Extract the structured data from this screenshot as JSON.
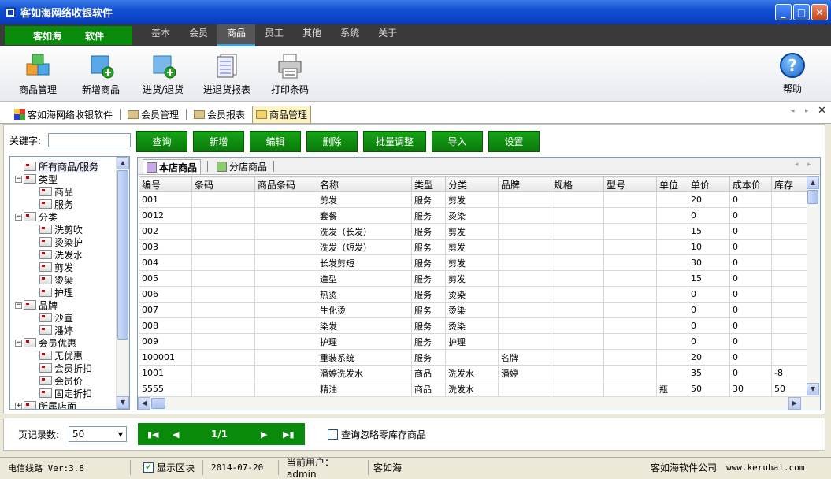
{
  "window": {
    "title": "客如海网络收银软件"
  },
  "brand": {
    "left": "客如海",
    "right": "软件"
  },
  "menu": [
    "基本",
    "会员",
    "商品",
    "员工",
    "其他",
    "系统",
    "关于"
  ],
  "toolbar": {
    "items": [
      "商品管理",
      "新增商品",
      "进货/退货",
      "进退货报表",
      "打印条码"
    ],
    "help": "帮助"
  },
  "tabs": [
    "客如海网络收银软件",
    "会员管理",
    "会员报表",
    "商品管理"
  ],
  "search": {
    "label": "关键字:",
    "value": ""
  },
  "buttons": [
    "查询",
    "新增",
    "编辑",
    "删除",
    "批量调整",
    "导入",
    "设置"
  ],
  "tree": [
    {
      "label": "所有商品/服务",
      "level": 0,
      "pm": ""
    },
    {
      "label": "类型",
      "level": 0,
      "pm": "-"
    },
    {
      "label": "商品",
      "level": 1,
      "pm": ""
    },
    {
      "label": "服务",
      "level": 1,
      "pm": ""
    },
    {
      "label": "分类",
      "level": 0,
      "pm": "-"
    },
    {
      "label": "洗剪吹",
      "level": 1,
      "pm": ""
    },
    {
      "label": "烫染护",
      "level": 1,
      "pm": ""
    },
    {
      "label": "洗发水",
      "level": 1,
      "pm": ""
    },
    {
      "label": "剪发",
      "level": 1,
      "pm": ""
    },
    {
      "label": "烫染",
      "level": 1,
      "pm": ""
    },
    {
      "label": "护理",
      "level": 1,
      "pm": ""
    },
    {
      "label": "品牌",
      "level": 0,
      "pm": "-"
    },
    {
      "label": "沙宣",
      "level": 1,
      "pm": ""
    },
    {
      "label": "潘婷",
      "level": 1,
      "pm": ""
    },
    {
      "label": "会员优惠",
      "level": 0,
      "pm": "-"
    },
    {
      "label": "无优惠",
      "level": 1,
      "pm": ""
    },
    {
      "label": "会员折扣",
      "level": 1,
      "pm": ""
    },
    {
      "label": "会员价",
      "level": 1,
      "pm": ""
    },
    {
      "label": "固定折扣",
      "level": 1,
      "pm": ""
    },
    {
      "label": "所属店面",
      "level": 0,
      "pm": "+"
    }
  ],
  "subtabs": [
    "本店商品",
    "分店商品"
  ],
  "columns": [
    "编号",
    "条码",
    "商品条码",
    "名称",
    "类型",
    "分类",
    "品牌",
    "规格",
    "型号",
    "单位",
    "单价",
    "成本价",
    "库存"
  ],
  "rows": [
    [
      "001",
      "",
      "",
      "剪发",
      "服务",
      "剪发",
      "",
      "",
      "",
      "",
      "20",
      "0",
      ""
    ],
    [
      "0012",
      "",
      "",
      "套餐",
      "服务",
      "烫染",
      "",
      "",
      "",
      "",
      "0",
      "0",
      ""
    ],
    [
      "002",
      "",
      "",
      "洗发（长发）",
      "服务",
      "剪发",
      "",
      "",
      "",
      "",
      "15",
      "0",
      ""
    ],
    [
      "003",
      "",
      "",
      "洗发（短发）",
      "服务",
      "剪发",
      "",
      "",
      "",
      "",
      "10",
      "0",
      ""
    ],
    [
      "004",
      "",
      "",
      "长发剪短",
      "服务",
      "剪发",
      "",
      "",
      "",
      "",
      "30",
      "0",
      ""
    ],
    [
      "005",
      "",
      "",
      "造型",
      "服务",
      "剪发",
      "",
      "",
      "",
      "",
      "15",
      "0",
      ""
    ],
    [
      "006",
      "",
      "",
      "热烫",
      "服务",
      "烫染",
      "",
      "",
      "",
      "",
      "0",
      "0",
      ""
    ],
    [
      "007",
      "",
      "",
      "生化烫",
      "服务",
      "烫染",
      "",
      "",
      "",
      "",
      "0",
      "0",
      ""
    ],
    [
      "008",
      "",
      "",
      "染发",
      "服务",
      "烫染",
      "",
      "",
      "",
      "",
      "0",
      "0",
      ""
    ],
    [
      "009",
      "",
      "",
      "护理",
      "服务",
      "护理",
      "",
      "",
      "",
      "",
      "0",
      "0",
      ""
    ],
    [
      "100001",
      "",
      "",
      "重装系统",
      "服务",
      "",
      "名牌",
      "",
      "",
      "",
      "20",
      "0",
      ""
    ],
    [
      "1001",
      "",
      "",
      "潘婷洗发水",
      "商品",
      "洗发水",
      "潘婷",
      "",
      "",
      "",
      "35",
      "0",
      "-8"
    ],
    [
      "5555",
      "",
      "",
      "精油",
      "商品",
      "洗发水",
      "",
      "",
      "",
      "瓶",
      "50",
      "30",
      "50"
    ]
  ],
  "pager": {
    "label": "页记录数:",
    "size": "50",
    "page": "1/1",
    "ignore_zero": "查询忽略零库存商品"
  },
  "status": {
    "line": "电信线路 Ver:3.8",
    "show_block": "显示区块",
    "date": "2014-07-20",
    "user": "当前用户：admin",
    "shop": "客如海",
    "company": "客如海软件公司",
    "site": "www.keruhai.com"
  },
  "colors": {
    "title": "#0A3FBF",
    "green": "#0A8A0A",
    "menubar": "#3A3A3A"
  }
}
